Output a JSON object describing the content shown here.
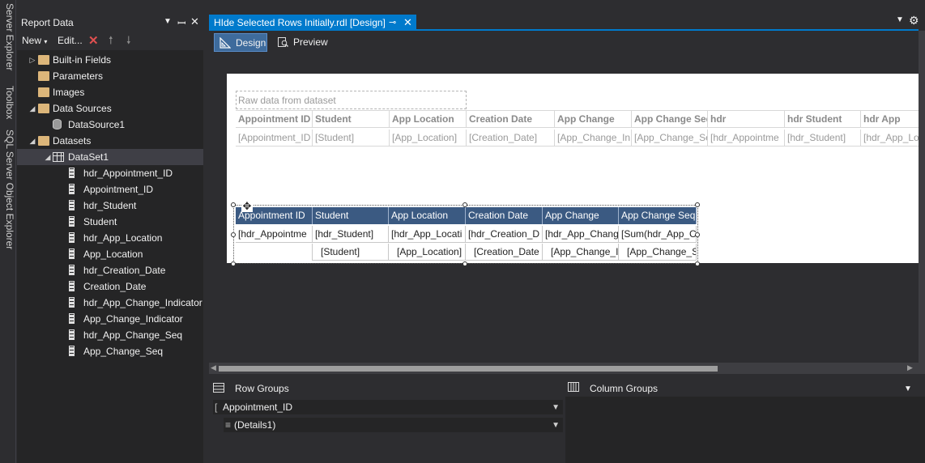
{
  "side_tabs": [
    "Server Explorer",
    "Toolbox",
    "SQL Server Object Explorer"
  ],
  "report_data": {
    "title": "Report Data",
    "toolbar": {
      "new_label": "New",
      "edit_label": "Edit..."
    },
    "tree": [
      {
        "label": "Built-in Fields",
        "level": 0,
        "type": "folder",
        "expanded": false
      },
      {
        "label": "Parameters",
        "level": 0,
        "type": "folder",
        "expanded": null
      },
      {
        "label": "Images",
        "level": 0,
        "type": "folder",
        "expanded": null
      },
      {
        "label": "Data Sources",
        "level": 0,
        "type": "folder",
        "expanded": true
      },
      {
        "label": "DataSource1",
        "level": 1,
        "type": "datasource",
        "expanded": null
      },
      {
        "label": "Datasets",
        "level": 0,
        "type": "folder",
        "expanded": true
      },
      {
        "label": "DataSet1",
        "level": 1,
        "type": "dataset",
        "expanded": true,
        "selected": true
      },
      {
        "label": "hdr_Appointment_ID",
        "level": 2,
        "type": "field"
      },
      {
        "label": "Appointment_ID",
        "level": 2,
        "type": "field"
      },
      {
        "label": "hdr_Student",
        "level": 2,
        "type": "field"
      },
      {
        "label": "Student",
        "level": 2,
        "type": "field"
      },
      {
        "label": "hdr_App_Location",
        "level": 2,
        "type": "field"
      },
      {
        "label": "App_Location",
        "level": 2,
        "type": "field"
      },
      {
        "label": "hdr_Creation_Date",
        "level": 2,
        "type": "field"
      },
      {
        "label": "Creation_Date",
        "level": 2,
        "type": "field"
      },
      {
        "label": "hdr_App_Change_Indicator",
        "level": 2,
        "type": "field"
      },
      {
        "label": "App_Change_Indicator",
        "level": 2,
        "type": "field"
      },
      {
        "label": "hdr_App_Change_Seq",
        "level": 2,
        "type": "field"
      },
      {
        "label": "App_Change_Seq",
        "level": 2,
        "type": "field"
      }
    ]
  },
  "document": {
    "tab_title": "HIde Selected Rows Initially.rdl [Design]",
    "views": {
      "design_label": "Design",
      "preview_label": "Preview"
    }
  },
  "raw_table": {
    "caption": "Raw data from dataset",
    "headers": [
      "Appointment ID",
      "Student",
      "App Location",
      "Creation Date",
      "App Change",
      "App Change Seq",
      "hdr",
      "hdr Student",
      "hdr App"
    ],
    "values": [
      "[Appointment_ID",
      "[Student]",
      "[App_Location]",
      "[Creation_Date]",
      "[App_Change_In",
      "[App_Change_Se",
      "[hdr_Appointme",
      "[hdr_Student]",
      "[hdr_App_Lo"
    ]
  },
  "grouped_table": {
    "headers": [
      "Appointment ID",
      "Student",
      "App Location",
      "Creation Date",
      "App Change",
      "App Change Seq"
    ],
    "row1": [
      "[hdr_Appointme",
      "[hdr_Student]",
      "[hdr_App_Locati",
      "[hdr_Creation_D",
      "[hdr_App_Chang",
      "[Sum(hdr_App_C"
    ],
    "row2": [
      "",
      "[Student]",
      "[App_Location]",
      "[Creation_Date",
      "[App_Change_I",
      "[App_Change_S"
    ]
  },
  "groups": {
    "row_groups_label": "Row Groups",
    "column_groups_label": "Column Groups",
    "row_groups": [
      "Appointment_ID",
      "(Details1)"
    ]
  },
  "colors": {
    "accent": "#007acc",
    "table_header": "#3b5a82",
    "folder": "#dcb67a"
  }
}
